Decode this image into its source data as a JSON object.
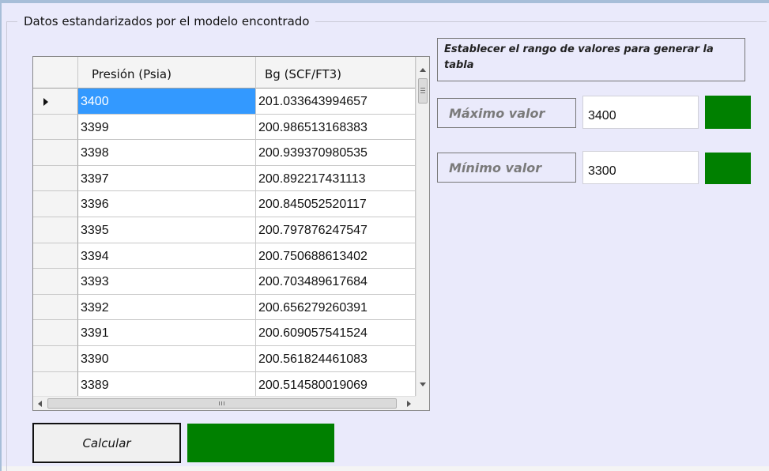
{
  "groupbox": {
    "title": "Datos estandarizados por el modelo encontrado"
  },
  "grid": {
    "columns": [
      "Presión (Psia)",
      "Bg (SCF/FT3)"
    ],
    "rows": [
      {
        "presion": "3400",
        "bg": "201.033643994657"
      },
      {
        "presion": "3399",
        "bg": "200.986513168383"
      },
      {
        "presion": "3398",
        "bg": "200.939370980535"
      },
      {
        "presion": "3397",
        "bg": "200.892217431113"
      },
      {
        "presion": "3396",
        "bg": "200.845052520117"
      },
      {
        "presion": "3395",
        "bg": "200.797876247547"
      },
      {
        "presion": "3394",
        "bg": "200.750688613402"
      },
      {
        "presion": "3393",
        "bg": "200.703489617684"
      },
      {
        "presion": "3392",
        "bg": "200.656279260391"
      },
      {
        "presion": "3391",
        "bg": "200.609057541524"
      },
      {
        "presion": "3390",
        "bg": "200.561824461083"
      },
      {
        "presion": "3389",
        "bg": "200.514580019069"
      }
    ],
    "selected_row": 0
  },
  "range": {
    "title": "Establecer el rango de valores para generar la tabla",
    "max_label": "Máximo valor",
    "max_value": "3400",
    "min_label": "Mínimo valor",
    "min_value": "3300"
  },
  "actions": {
    "calculate_label": "Calcular"
  },
  "colors": {
    "indicator_green": "#008000",
    "selection": "#3399ff",
    "panel_background": "#eaeafb"
  }
}
